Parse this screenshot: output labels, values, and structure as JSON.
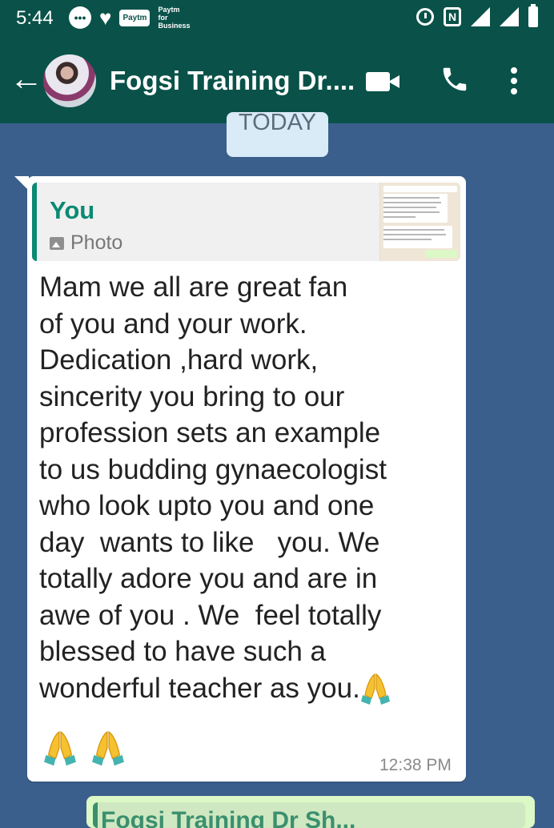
{
  "status_bar": {
    "time": "5:44",
    "paytm_label": "Paytm",
    "paytm_business_label": "Paytm for Business",
    "nfc_label": "N"
  },
  "chat": {
    "title": "Fogsi Training Dr....",
    "colors": {
      "header": "#0a5249",
      "wallpaper": "#3a5f8c",
      "accent": "#0a8a73"
    }
  },
  "date_separator": "TODAY",
  "message": {
    "quote": {
      "author": "You",
      "media_label": "Photo"
    },
    "text": "Mam we all are great fan\nof you and your work.\nDedication ,hard work,\nsincerity you bring to our\nprofession sets an example\nto us budding gynaecologist\nwho look upto you and one\nday  wants to like   you. We\ntotally adore you and are in\nawe of you . We  feel totally\nblessed to have such a\nwonderful teacher as you.",
    "time": "12:38 PM",
    "emoji_icons": [
      "folded-hands-icon",
      "folded-hands-icon",
      "folded-hands-icon"
    ]
  },
  "next_message": {
    "quote_author": "Fogsi Training Dr Sh..."
  }
}
